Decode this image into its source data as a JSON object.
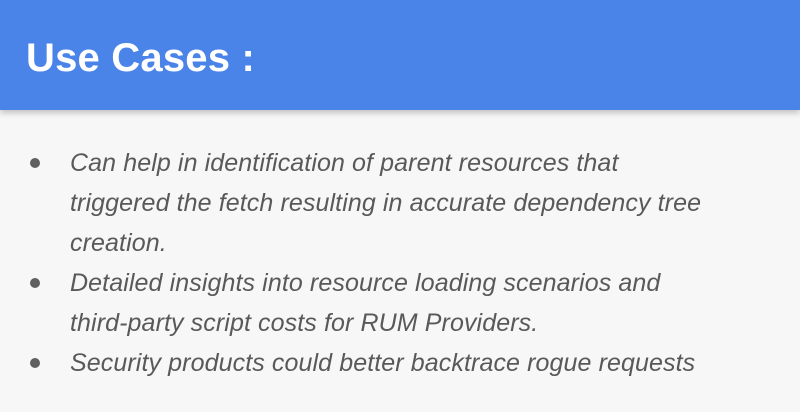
{
  "header": {
    "title": "Use Cases :",
    "background_color": "#4a84e8",
    "text_color": "#ffffff"
  },
  "bullets": [
    {
      "lines": [
        "Can help in identification of parent resources that",
        "triggered the fetch resulting in accurate dependency tree",
        "creation."
      ]
    },
    {
      "lines": [
        "Detailed insights into resource loading scenarios and",
        "third-party script costs for RUM Providers."
      ]
    },
    {
      "lines": [
        "Security products could better backtrace rogue requests"
      ]
    }
  ],
  "colors": {
    "body_background": "#f7f7f7",
    "body_text": "#595959",
    "bullet_dot": "#5f5f5f"
  }
}
